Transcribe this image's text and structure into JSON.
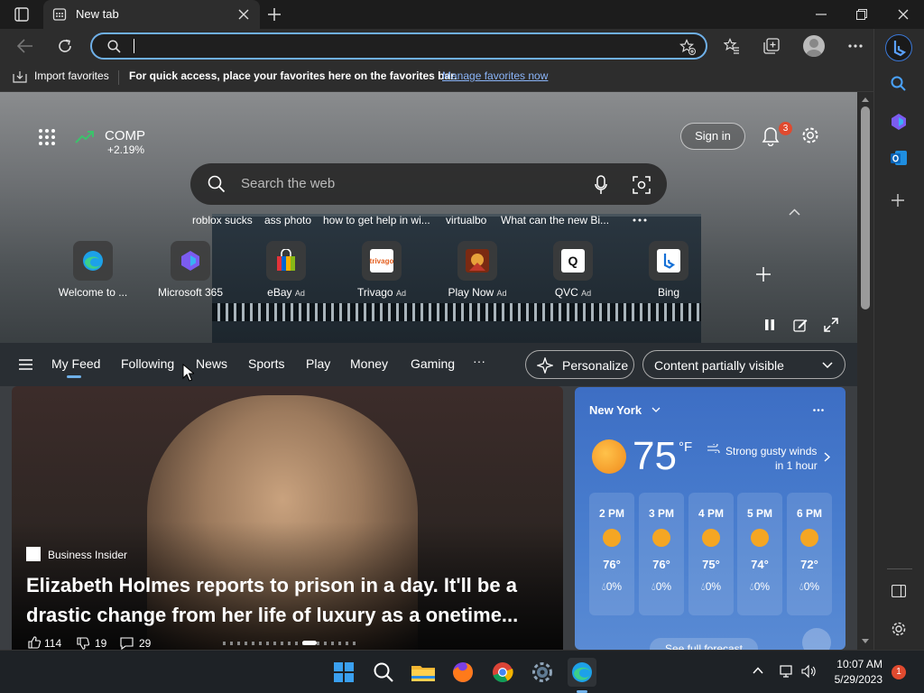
{
  "browser": {
    "tab_title": "New tab",
    "address_value": "",
    "favorites_bar": {
      "import_label": "Import favorites",
      "hint": "For quick access, place your favorites here on the favorites bar.",
      "manage_link": "Manage favorites now"
    }
  },
  "newtab": {
    "ticker": {
      "symbol": "COMP",
      "change": "+2.19%"
    },
    "sign_in": "Sign in",
    "notification_count": "3",
    "search_placeholder": "Search the web",
    "trending": [
      "roblox sucks",
      "ass photo",
      "how to get help in wi...",
      "virtualbo",
      "What can the new Bi..."
    ],
    "quick_links": [
      {
        "label": "Welcome to ...",
        "ad": ""
      },
      {
        "label": "Microsoft 365",
        "ad": ""
      },
      {
        "label": "eBay",
        "ad": "Ad"
      },
      {
        "label": "Trivago",
        "ad": "Ad"
      },
      {
        "label": "Play Now",
        "ad": "Ad"
      },
      {
        "label": "QVC",
        "ad": "Ad"
      },
      {
        "label": "Bing",
        "ad": ""
      }
    ],
    "quick_tile_texts": {
      "trivago": "trivago",
      "qvc": "Q"
    },
    "feed_tabs": [
      "My Feed",
      "Following",
      "News",
      "Sports",
      "Play",
      "Money",
      "Gaming",
      "···"
    ],
    "personalize": "Personalize",
    "content_visibility": "Content partially visible",
    "article": {
      "source": "Business Insider",
      "headline_line1": "Elizabeth Holmes reports to prison in a day. It'll be a",
      "headline_line2": "drastic change from her life of luxury as a onetime...",
      "likes": "114",
      "dislikes": "19",
      "comments": "29"
    },
    "weather": {
      "city": "New York",
      "temp": "75",
      "unit": "°F",
      "alert_line1": "Strong gusty winds",
      "alert_line2": "in 1 hour",
      "hourly": [
        {
          "time": "2 PM",
          "temp": "76°",
          "precip": "0%"
        },
        {
          "time": "3 PM",
          "temp": "76°",
          "precip": "0%"
        },
        {
          "time": "4 PM",
          "temp": "75°",
          "precip": "0%"
        },
        {
          "time": "5 PM",
          "temp": "74°",
          "precip": "0%"
        },
        {
          "time": "6 PM",
          "temp": "72°",
          "precip": "0%"
        }
      ],
      "full_forecast": "See full forecast"
    }
  },
  "taskbar": {
    "time": "10:07 AM",
    "date": "5/29/2023",
    "notification_count": "1"
  },
  "colors": {
    "accent": "#6fb0e8",
    "link": "#8ab4f8",
    "sun": "#f5a623",
    "badge": "#e04a2f"
  }
}
